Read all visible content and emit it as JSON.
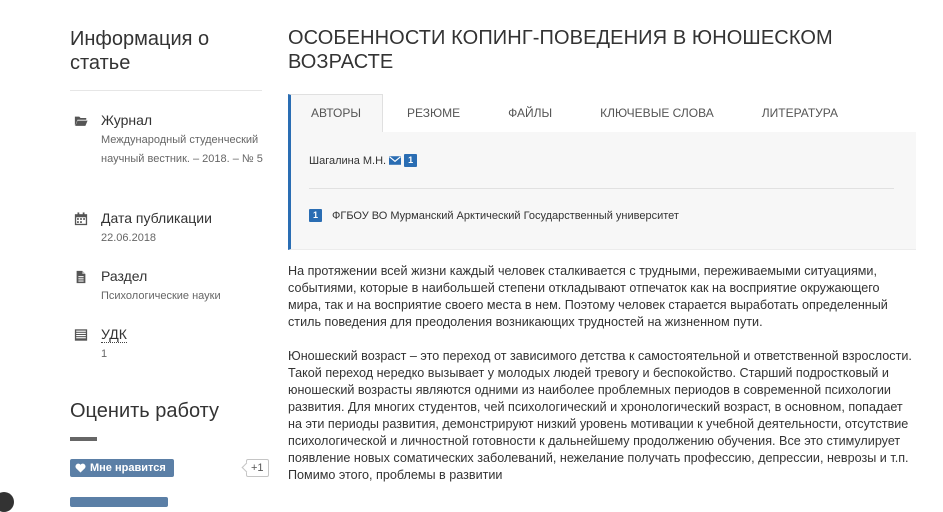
{
  "sidebar": {
    "title": "Информация о статье",
    "items": [
      {
        "icon": "folder-open-icon",
        "label": "Журнал",
        "value": "Международный студенческий научный вестник. – 2018. – № 5"
      },
      {
        "icon": "calendar-icon",
        "label": "Дата публикации",
        "value": "22.06.2018"
      },
      {
        "icon": "file-icon",
        "label": "Раздел",
        "value": "Психологические науки"
      },
      {
        "icon": "book-icon",
        "label": "УДК",
        "value": "1"
      }
    ],
    "rate": {
      "title": "Оценить работу",
      "like_label": "Мне нравится",
      "like_count": "+1"
    }
  },
  "article": {
    "title": "ОСОБЕННОСТИ КОПИНГ-ПОВЕДЕНИЯ В ЮНОШЕСКОМ ВОЗРАСТЕ",
    "tabs": [
      {
        "label": "Авторы",
        "active": true
      },
      {
        "label": "Резюме",
        "active": false
      },
      {
        "label": "Файлы",
        "active": false
      },
      {
        "label": "Ключевые слова",
        "active": false
      },
      {
        "label": "Литература",
        "active": false
      }
    ],
    "authors_panel": {
      "author_name": "Шагалина М.Н.",
      "author_badge": "1",
      "affiliation_badge": "1",
      "affiliation": "ФГБОУ ВО Мурманский Арктический Государственный университет"
    },
    "paragraphs": [
      "На протяжении всей жизни каждый человек сталкивается с трудными, переживаемыми ситуациями, событиями, которые в наибольшей степени откладывают отпечаток как на восприятие окружающего мира, так и на восприятие своего места в нем. Поэтому человек старается выработать определенный стиль поведения для преодоления возникающих трудностей на жизненном пути.",
      "Юношеский возраст – это переход от зависимого детства к самостоятельной и ответственной взрослости. Такой переход нередко вызывает у молодых людей тревогу и беспокойство. Старший подростковый и юношеский возрасты являются одними из наиболее проблемных периодов в современной психологии развития. Для многих студентов, чей психологический и хронологический возраст, в основном, попадает на эти периоды развития, демонстрируют низкий уровень мотивации к учебной деятельности, отсутствие психологической и личностной готовности к дальнейшему продолжению обучения. Все это стимулирует появление новых соматических заболеваний, нежелание получать профессию, депрессии, неврозы и т.п. Помимо этого, проблемы в развитии"
    ]
  },
  "colors": {
    "accent": "#2a6db3",
    "like_button": "#5b7fa6",
    "panel_bg": "#f7f7f7"
  }
}
